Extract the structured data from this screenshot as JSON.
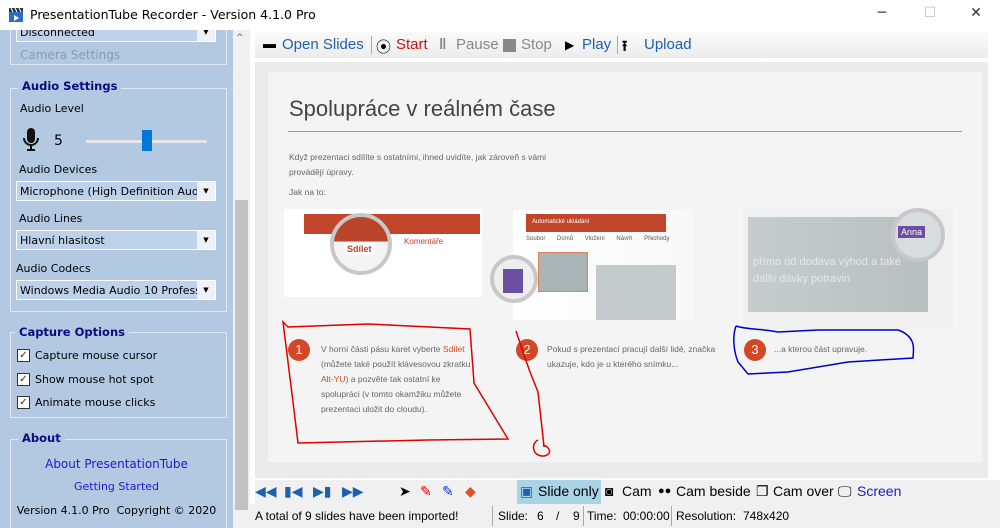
{
  "window": {
    "title": "PresentationTube Recorder - Version 4.1.0 Pro",
    "min": "─",
    "max": "☐",
    "close": "✕"
  },
  "left": {
    "camera_combo": "Disconnected",
    "camera_settings": "Camera Settings",
    "audio": {
      "header": "Audio Settings",
      "level_label": "Audio Level",
      "level_value": "5",
      "level_fraction": 0.5,
      "devices_label": "Audio Devices",
      "device": "Microphone (High Definition Audio De",
      "lines_label": "Audio Lines",
      "line": "Hlavní hlasitost",
      "codecs_label": "Audio Codecs",
      "codec": "Windows Media Audio 10 Professiona"
    },
    "capture": {
      "header": "Capture Options",
      "options": [
        {
          "label": "Capture mouse cursor",
          "checked": true
        },
        {
          "label": "Show mouse hot spot",
          "checked": true
        },
        {
          "label": "Animate mouse clicks",
          "checked": true
        }
      ]
    },
    "about": {
      "header": "About",
      "link1": "About PresentationTube",
      "link2": "Getting Started",
      "version": "Version 4.1.0 Pro  Copyright © 2020"
    }
  },
  "toolbar": {
    "open": "Open Slides",
    "start": "Start",
    "pause": "Pause",
    "stop": "Stop",
    "play": "Play",
    "upload": "Upload"
  },
  "slide": {
    "title": "Spolupráce v reálném čase",
    "intro": "Když prezentaci sdílíte s ostatními, ihned uvidíte, jak zároveň s vámi provádějí úpravy.",
    "howto": "Jak na to:",
    "share_btn": "Sdílet",
    "comments_btn": "Komentáře",
    "autosave": "Automatické ukládání",
    "ribbon": [
      "Soubor",
      "Domů",
      "Vložení",
      "Návrh",
      "Přechody"
    ],
    "anna": "Anna",
    "faded": "přímo od dodava výhod a také další dávky potravin",
    "steps": [
      {
        "n": "1",
        "text_pre": "V horní části pásu karet vyberte ",
        "hl1": "Sdílet",
        "text_mid": " (můžete také použít klávesovou zkratku ",
        "hl2": "Alt-YU",
        "text_post": ") a pozvěte tak ostatní ke spolupráci (v tomto okamžiku můžete prezentaci uložit do cloudu)."
      },
      {
        "n": "2",
        "text": "Pokud s prezentací pracují další lidé, značka ukazuje, kdo je u kterého snímku..."
      },
      {
        "n": "3",
        "text": "...a kterou část upravuje."
      }
    ],
    "colors": {
      "accent": "#d24726",
      "ink_red": "#e00000",
      "ink_blue": "#0000c8"
    }
  },
  "bottom": {
    "slide_only": "Slide only",
    "cam": "Cam",
    "cam_beside": "Cam beside",
    "cam_over": "Cam over",
    "screen": "Screen",
    "highlight": "#a8d4e6"
  },
  "status": {
    "message": "A total of 9 slides have been imported!",
    "slide_label": "Slide:",
    "slide_current": "6",
    "slide_sep": "/",
    "slide_total": "9",
    "time_label": "Time:",
    "time": "00:00:00",
    "res_label": "Resolution:",
    "res": "748x420"
  }
}
